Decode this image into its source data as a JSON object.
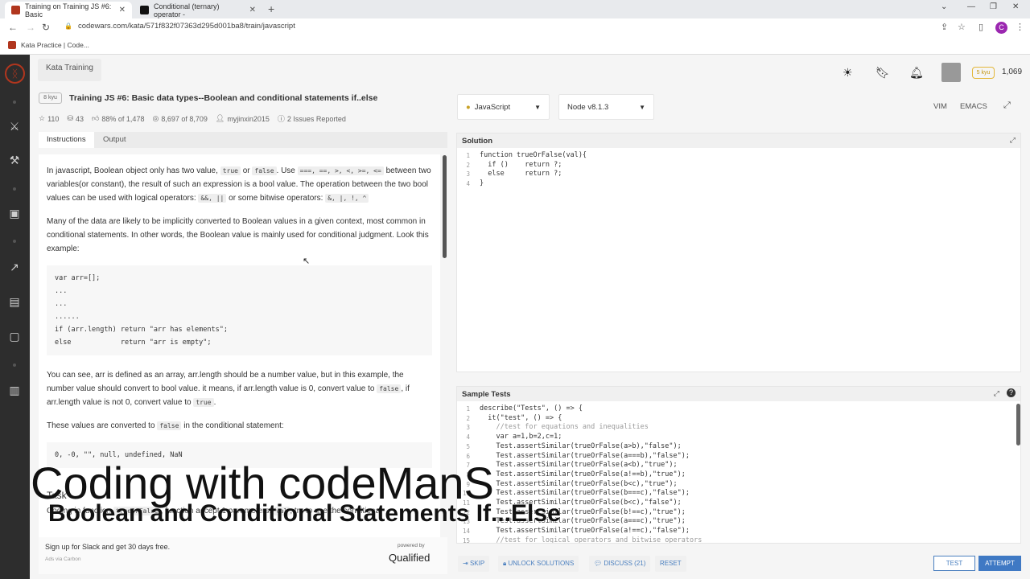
{
  "browser": {
    "tabs": [
      {
        "title": "Training on Training JS #6: Basic",
        "active": true,
        "favicon_color": "#b1361e"
      },
      {
        "title": "Conditional (ternary) operator -",
        "active": false,
        "favicon_color": "#111111"
      }
    ],
    "new_tab": "+",
    "url": "codewars.com/kata/571f832f07363d295d001ba8/train/javascript",
    "bookmark": "Kata Practice | Code...",
    "profile_initial": "C"
  },
  "kata": {
    "training_button": "Kata Training",
    "kyu": "8 kyu",
    "title": "Training JS #6: Basic data types--Boolean and conditional statements if..else",
    "stats": {
      "stars": "110",
      "collections": "43",
      "satisfaction": "88% of 1,478",
      "completed": "8,697 of 8,709",
      "author": "myjinxin2015",
      "issues": "2 Issues Reported"
    },
    "tabs": {
      "instructions": "Instructions",
      "output": "Output"
    }
  },
  "instructions": {
    "p1_a": "In javascript, Boolean object only has two value,",
    "p1_true": "true",
    "p1_or": "or",
    "p1_false": "false",
    "p1_b": ". Use",
    "p1_ops": "===, ==, >, <, >=, <=",
    "p1_c": "between two variables(or constant), the result of such an expression is a bool value. The operation between the two bool values can be used with logical operators:",
    "p1_logic": "&&, ||",
    "p1_d": "or some bitwise operators:",
    "p1_bitwise": "&, |, !, ^",
    "p2": "Many of the data are likely to be implicitly converted to Boolean values in a given context, most common in conditional statements. In other words, the Boolean value is mainly used for conditional judgment. Look this example:",
    "code1": "var arr=[];\n...\n...\n......\nif (arr.length) return \"arr has elements\";\nelse            return \"arr is empty\";",
    "p3_a": "You can see, arr is defined as an array, arr.length should be a number value, but in this example, the number value should convert to bool value. it means, if arr.length value is 0, convert value to",
    "p3_false": "false",
    "p3_b": ", if arr.length value is not 0, convert value to",
    "p3_true": "true",
    "p3_c": ".",
    "p4_a": "These values are converted to",
    "p4_false": "false",
    "p4_b": "in the conditional statement:",
    "code2": "0, -0, \"\", null, undefined, NaN",
    "task_heading": "Task",
    "task_a": "Coding in function",
    "task_fn": "trueOrFalse",
    "task_b": ", function accept 1 parameters:",
    "task_param": "val",
    "task_c": ", try to use the conditional"
  },
  "ad": {
    "text": "Sign up for Slack and get 30 days free.",
    "sub": "Ads via Carbon",
    "powered": "powered by",
    "brand": "Qualified"
  },
  "overlay": {
    "line1": "Coding with codeManS",
    "line2": "Boolean and Conditional Statements If...Else"
  },
  "header": {
    "rank": "5 kyu",
    "honor": "1,069"
  },
  "editor": {
    "language": "JavaScript",
    "version": "Node v8.1.3",
    "mode_vim": "VIM",
    "mode_emacs": "EMACS",
    "solution_label": "Solution",
    "solution_lines": [
      "function trueOrFalse(val){",
      "  if ()    return ?;",
      "  else     return ?;",
      "}"
    ],
    "tests_label": "Sample Tests",
    "test_lines": [
      "describe(\"Tests\", () => {",
      "  it(\"test\", () => {",
      "    //test for equations and inequalities",
      "    var a=1,b=2,c=1;",
      "    Test.assertSimilar(trueOrFalse(a>b),\"false\");",
      "    Test.assertSimilar(trueOrFalse(a===b),\"false\");",
      "    Test.assertSimilar(trueOrFalse(a<b),\"true\");",
      "    Test.assertSimilar(trueOrFalse(a!==b),\"true\");",
      "    Test.assertSimilar(trueOrFalse(b<c),\"true\");",
      "    Test.assertSimilar(trueOrFalse(b===c),\"false\");",
      "    Test.assertSimilar(trueOrFalse(b<c),\"false\");",
      "    Test.assertSimilar(trueOrFalse(b!==c),\"true\");",
      "    Test.assertSimilar(trueOrFalse(a===c),\"true\");",
      "    Test.assertSimilar(trueOrFalse(a!==c),\"false\");",
      "    //test for logical operators and bitwise operators"
    ]
  },
  "actions": {
    "skip": "SKIP",
    "unlock": "UNLOCK SOLUTIONS",
    "discuss": "DISCUSS (21)",
    "reset": "RESET",
    "test": "TEST",
    "attempt": "ATTEMPT"
  }
}
